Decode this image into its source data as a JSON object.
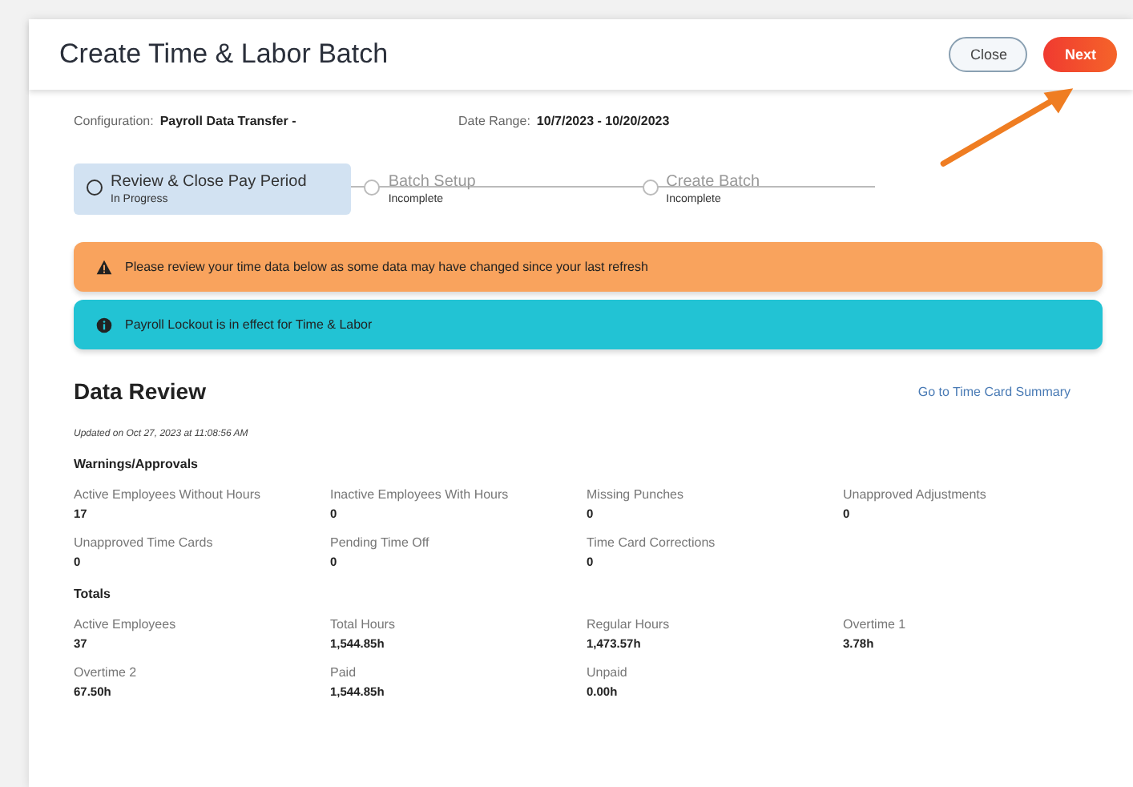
{
  "dialog": {
    "title": "Create Time & Labor Batch",
    "buttons": [
      {
        "label": "Close",
        "kind": "secondary"
      },
      {
        "label": "Next",
        "kind": "primary"
      }
    ]
  },
  "info": [
    {
      "label": "Configuration:",
      "value": "Payroll Data Transfer -"
    },
    {
      "label": "Date Range:",
      "value": "10/7/2023 - 10/20/2023"
    }
  ],
  "steps": [
    {
      "title": "Review & Close Pay Period",
      "status": "In Progress",
      "selected": true
    },
    {
      "title": "Batch Setup",
      "status": "Incomplete",
      "selected": false
    },
    {
      "title": "Create Batch",
      "status": "Incomplete",
      "selected": false
    }
  ],
  "banners": [
    {
      "kind": "warning",
      "text": "Please review your time data below as some data may have changed since your last refresh"
    },
    {
      "kind": "info",
      "text": "Payroll Lockout is in effect for Time & Labor"
    }
  ],
  "data_review": {
    "title": "Data Review",
    "link": "Go to Time Card Summary",
    "updated": "Updated on Oct 27, 2023 at 11:08:56 AM",
    "sections": [
      {
        "title": "Warnings/Approvals",
        "metrics": [
          {
            "label": "Active Employees Without Hours",
            "value": "17"
          },
          {
            "label": "Inactive Employees With Hours",
            "value": "0"
          },
          {
            "label": "Missing Punches",
            "value": "0"
          },
          {
            "label": "Unapproved Adjustments",
            "value": "0"
          },
          {
            "label": "Unapproved Time Cards",
            "value": "0"
          },
          {
            "label": "Pending Time Off",
            "value": "0"
          },
          {
            "label": "Time Card Corrections",
            "value": "0"
          }
        ]
      },
      {
        "title": "Totals",
        "metrics": [
          {
            "label": "Active Employees",
            "value": "37"
          },
          {
            "label": "Total Hours",
            "value": "1,544.85h"
          },
          {
            "label": "Regular Hours",
            "value": "1,473.57h"
          },
          {
            "label": "Overtime 1",
            "value": "3.78h"
          },
          {
            "label": "Overtime 2",
            "value": "67.50h"
          },
          {
            "label": "Paid",
            "value": "1,544.85h"
          },
          {
            "label": "Unpaid",
            "value": "0.00h"
          }
        ]
      }
    ]
  }
}
